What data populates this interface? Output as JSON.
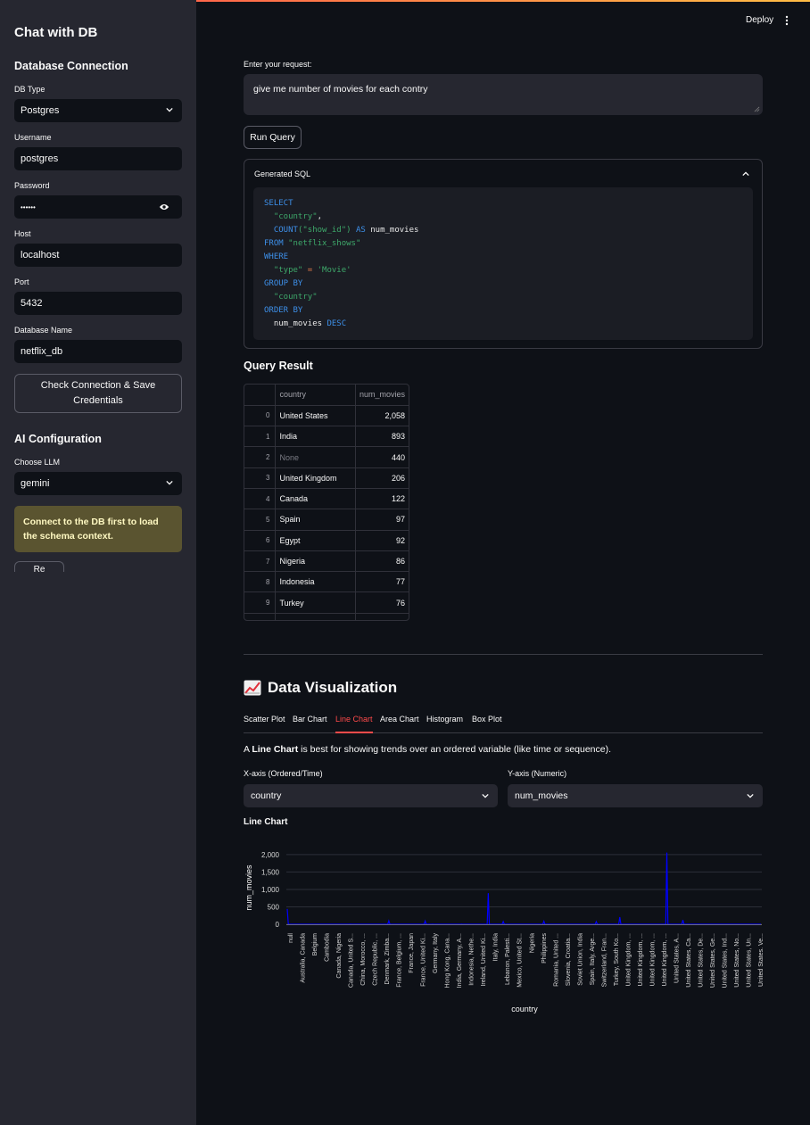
{
  "sidebar": {
    "app_title": "Chat with DB",
    "db_section_title": "Database Connection",
    "db_type": {
      "label": "DB Type",
      "value": "Postgres"
    },
    "username": {
      "label": "Username",
      "value": "postgres"
    },
    "password": {
      "label": "Password",
      "value": "••••••"
    },
    "host": {
      "label": "Host",
      "value": "localhost"
    },
    "port": {
      "label": "Port",
      "value": "5432"
    },
    "db_name": {
      "label": "Database Name",
      "value": "netflix_db"
    },
    "check_button_label": "Check Connection & Save Credentials",
    "ai_section_title": "AI Configuration",
    "llm": {
      "label": "Choose LLM",
      "value": "gemini"
    },
    "warning_text": "Connect to the DB first to load the schema context.",
    "partial_button_label": "Re"
  },
  "header": {
    "deploy_label": "Deploy",
    "menu_icon": "kebab-menu-icon"
  },
  "request": {
    "label": "Enter your request:",
    "value": "give me number of movies for each contry"
  },
  "run_button_label": "Run Query",
  "sql_expander": {
    "title": "Generated SQL",
    "expanded": true
  },
  "query_result": {
    "title": "Query Result",
    "columns": [
      "country",
      "num_movies"
    ],
    "rows": [
      {
        "idx": "0",
        "country": "United States",
        "num_movies": "2,058"
      },
      {
        "idx": "1",
        "country": "India",
        "num_movies": "893"
      },
      {
        "idx": "2",
        "country": "None",
        "num_movies": "440"
      },
      {
        "idx": "3",
        "country": "United Kingdom",
        "num_movies": "206"
      },
      {
        "idx": "4",
        "country": "Canada",
        "num_movies": "122"
      },
      {
        "idx": "5",
        "country": "Spain",
        "num_movies": "97"
      },
      {
        "idx": "6",
        "country": "Egypt",
        "num_movies": "92"
      },
      {
        "idx": "7",
        "country": "Nigeria",
        "num_movies": "86"
      },
      {
        "idx": "8",
        "country": "Indonesia",
        "num_movies": "77"
      },
      {
        "idx": "9",
        "country": "Turkey",
        "num_movies": "76"
      }
    ]
  },
  "visualization": {
    "title": "Data Visualization",
    "icon": "chart-increasing-icon",
    "tabs": [
      "Scatter Plot",
      "Bar Chart",
      "Line Chart",
      "Area Chart",
      "Histogram",
      "Box Plot"
    ],
    "active_tab": "Line Chart",
    "description_prefix": "A ",
    "description_bold": "Line Chart",
    "description_suffix": " is best for showing trends over an ordered variable (like time or sequence).",
    "x_axis": {
      "label": "X-axis (Ordered/Time)",
      "value": "country"
    },
    "y_axis": {
      "label": "Y-axis (Numeric)",
      "value": "num_movies"
    },
    "chart_title": "Line Chart"
  },
  "colors": {
    "accent": "#ff4b4b",
    "line": "#0000ff",
    "warning_bg": "#5a5430"
  },
  "chart_data": {
    "type": "line",
    "xlabel": "country",
    "ylabel": "num_movies",
    "ylim": [
      0,
      2100
    ],
    "yticks": [
      0,
      500,
      1000,
      1500,
      2000
    ],
    "ytick_labels": [
      "0",
      "500",
      "1,000",
      "1,500",
      "2,000"
    ],
    "grid": true,
    "tick_labels": [
      "null",
      "Australia, Canada",
      "Belgium",
      "Cambodia",
      "Canada, Nigeria",
      "Canada, United S...",
      "China, Morocco, ...",
      "Czech Republic, ...",
      "Denmark, Zimba...",
      "France, Belgium, ...",
      "France, Japan",
      "France, United Ki...",
      "Germany, Italy",
      "Hong Kong, Cana...",
      "India, Germany, A...",
      "Indonesia, Nethe...",
      "Ireland, United Ki...",
      "Italy, India",
      "Lebanon, Palesti...",
      "Mexico, United St...",
      "Nigeria",
      "Philippines",
      "Romania, United ...",
      "Slovenia, Croatia...",
      "Soviet Union, India",
      "Spain, Italy, Arge...",
      "Switzerland, Fran...",
      "Turkey, South Ko...",
      "United Kingdom, ...",
      "United Kingdom, ...",
      "United Kingdom, ...",
      "United Kingdom, ...",
      "United States, A...",
      "United States, Ca...",
      "United States, De...",
      "United States, Ge...",
      "United States, Ind...",
      "United States, No...",
      "United States, Un...",
      "United States, Ve..."
    ],
    "series": [
      {
        "values": [
          440,
          3,
          1,
          2,
          1,
          2,
          1,
          1,
          2,
          1,
          1,
          1,
          2,
          1,
          1,
          1,
          1,
          1,
          1,
          1,
          1,
          1,
          1,
          1,
          1,
          2,
          1,
          1,
          1,
          1,
          1,
          1,
          1,
          1,
          1,
          1,
          1,
          2,
          1,
          1,
          1,
          2,
          1,
          1,
          1,
          1,
          1,
          1,
          1,
          1,
          1,
          1,
          2,
          1,
          1,
          1,
          1,
          1,
          1,
          5,
          1,
          2,
          1,
          1,
          1,
          1,
          1,
          1,
          1,
          1,
          1,
          1,
          1,
          1,
          1,
          1,
          1,
          1,
          1,
          1,
          1,
          1,
          1,
          1,
          1,
          1,
          1,
          1,
          1,
          1,
          1,
          2,
          1,
          1,
          1,
          97,
          1,
          1,
          1,
          1,
          1,
          1,
          1,
          1,
          2,
          1,
          1,
          1,
          2,
          1,
          1,
          1,
          1,
          1,
          1,
          1,
          1,
          1,
          1,
          1,
          1,
          1,
          1,
          1,
          1,
          1,
          1,
          1,
          1,
          92,
          1,
          1,
          1,
          1,
          1,
          1,
          3,
          1,
          1,
          1,
          1,
          1,
          1,
          1,
          1,
          1,
          1,
          1,
          1,
          1,
          1,
          1,
          1,
          1,
          1,
          1,
          1,
          1,
          1,
          1,
          1,
          1,
          1,
          4,
          1,
          1,
          1,
          1,
          1,
          1,
          1,
          1,
          1,
          1,
          1,
          1,
          1,
          1,
          1,
          1,
          1,
          1,
          1,
          1,
          1,
          1,
          1,
          1,
          893,
          1,
          1,
          1,
          1,
          1,
          1,
          1,
          1,
          2,
          1,
          1,
          1,
          1,
          77,
          1,
          1,
          1,
          1,
          1,
          1,
          1,
          1,
          1,
          1,
          1,
          1,
          1,
          1,
          2,
          1,
          1,
          1,
          1,
          1,
          1,
          1,
          1,
          1,
          1,
          1,
          1,
          1,
          1,
          1,
          1,
          1,
          1,
          1,
          1,
          1,
          1,
          86,
          1,
          1,
          1,
          1,
          1,
          1,
          1,
          1,
          1,
          1,
          1,
          1,
          1,
          1,
          1,
          1,
          1,
          1,
          1,
          1,
          1,
          1,
          1,
          1,
          1,
          1,
          1,
          1,
          1,
          1,
          1,
          1,
          1,
          1,
          1,
          1,
          1,
          1,
          1,
          1,
          1,
          1,
          1,
          1,
          1,
          1,
          1,
          1,
          76,
          1,
          1,
          1,
          1,
          1,
          1,
          1,
          1,
          1,
          1,
          1,
          1,
          1,
          1,
          1,
          1,
          1,
          1,
          1,
          1,
          1,
          206,
          1,
          1,
          1,
          1,
          1,
          1,
          1,
          1,
          1,
          1,
          1,
          1,
          1,
          1,
          1,
          1,
          1,
          1,
          1,
          1,
          1,
          1,
          1,
          1,
          1,
          1,
          1,
          1,
          1,
          1,
          1,
          1,
          1,
          1,
          1,
          1,
          1,
          1,
          1,
          1,
          1,
          1,
          1,
          2058,
          1,
          1,
          1,
          1,
          1,
          1,
          1,
          1,
          1,
          1,
          1,
          1,
          1,
          1,
          122,
          1,
          1,
          1,
          1,
          1,
          1,
          1,
          1,
          1,
          1,
          1,
          1,
          1,
          1,
          1,
          1,
          1,
          1,
          1,
          1,
          1,
          1,
          1,
          1,
          1,
          1,
          1,
          1,
          1,
          1,
          1,
          1,
          1,
          1,
          1,
          1,
          1,
          1,
          1,
          1,
          1,
          1,
          1,
          1,
          1,
          1,
          1,
          1,
          1,
          1,
          1,
          1,
          1,
          1,
          1,
          1,
          1,
          1,
          1,
          1,
          1,
          1,
          1,
          1,
          1,
          1,
          1,
          1,
          1,
          1,
          1,
          1,
          1
        ]
      }
    ]
  }
}
